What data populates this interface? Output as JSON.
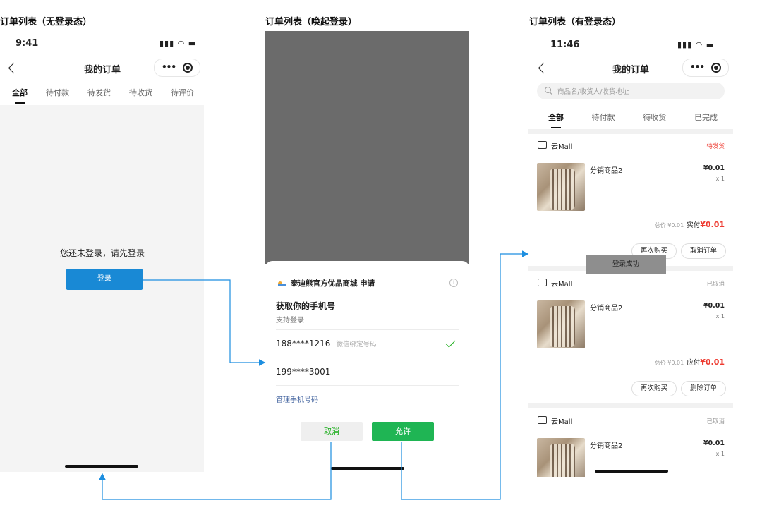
{
  "panels": [
    {
      "title": "订单列表（无登录态）"
    },
    {
      "title": "订单列表（唤起登录）"
    },
    {
      "title": "订单列表（有登录态）"
    }
  ],
  "p1": {
    "time": "9:41",
    "nav_title": "我的订单",
    "tabs": [
      "全部",
      "待付款",
      "待发货",
      "待收货",
      "待评价"
    ],
    "message": "您还未登录，请先登录",
    "login_label": "登录"
  },
  "p2": {
    "app_name": "泰迪熊官方优品商城  申请",
    "title": "获取你的手机号",
    "subtitle": "支持登录",
    "phone1": "188****1216",
    "phone1_hint": "微信绑定号码",
    "phone2": "199****3001",
    "manage_label": "管理手机号码",
    "cancel_label": "取消",
    "allow_label": "允许"
  },
  "p3": {
    "time": "11:46",
    "nav_title": "我的订单",
    "search_placeholder": "商品名/收货人/收货地址",
    "tabs": [
      "全部",
      "待付款",
      "待收货",
      "已完成"
    ],
    "toast": "登录成功",
    "orders": [
      {
        "store": "云Mall",
        "status": "待发货",
        "product": "分销商品2",
        "price": "¥0.01",
        "qty": "x 1",
        "total_prefix": "总价 ¥0.01",
        "total_label": "实付",
        "total_amount": "¥0.01",
        "btn1": "再次购买",
        "btn2": "取消订单"
      },
      {
        "store": "云Mall",
        "status": "已取消",
        "product": "分销商品2",
        "price": "¥0.01",
        "qty": "x 1",
        "total_prefix": "总价 ¥0.01",
        "total_label": "应付",
        "total_amount": "¥0.01",
        "btn1": "再次购买",
        "btn2": "删除订单"
      },
      {
        "store": "云Mall",
        "status": "已取消",
        "product": "分销商品2",
        "price": "¥0.01",
        "qty": "x 1"
      }
    ]
  },
  "colors": {
    "accent_blue": "#1989d5",
    "wechat_green": "#1fb554",
    "price_red": "#ee3a30"
  }
}
